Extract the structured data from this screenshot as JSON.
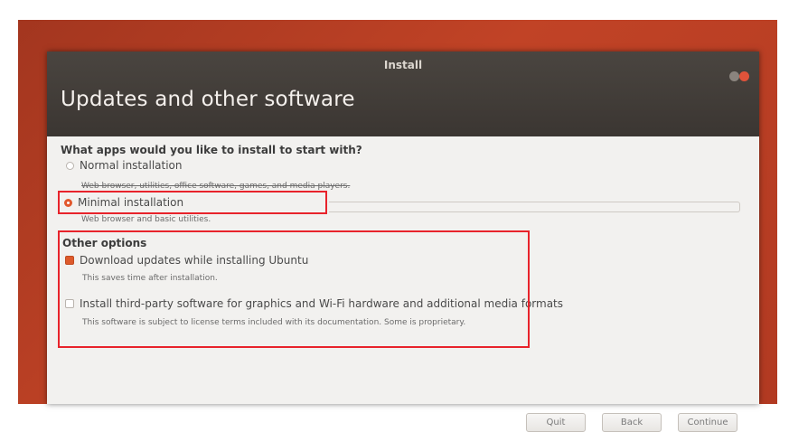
{
  "window": {
    "title": "Install",
    "page_title": "Updates and other software"
  },
  "apps_question": "What apps would you like to install to start with?",
  "installation_options": [
    {
      "label": "Normal installation",
      "description": "Web browser, utilities, office software, games, and media players.",
      "selected": false
    },
    {
      "label": "Minimal installation",
      "description": "Web browser and basic utilities.",
      "selected": true
    }
  ],
  "other_options": {
    "title": "Other options",
    "items": [
      {
        "label": "Download updates while installing Ubuntu",
        "description": "This saves time after installation.",
        "checked": true
      },
      {
        "label": "Install third-party software for graphics and Wi-Fi hardware and additional media formats",
        "description": "This software is subject to license terms included with its documentation. Some is proprietary.",
        "checked": false
      }
    ]
  },
  "buttons": {
    "quit": "Quit",
    "back": "Back",
    "continue": "Continue"
  },
  "colors": {
    "accent": "#e1582d",
    "annotation": "#e8232b",
    "wallpaper": "#b23a22"
  }
}
